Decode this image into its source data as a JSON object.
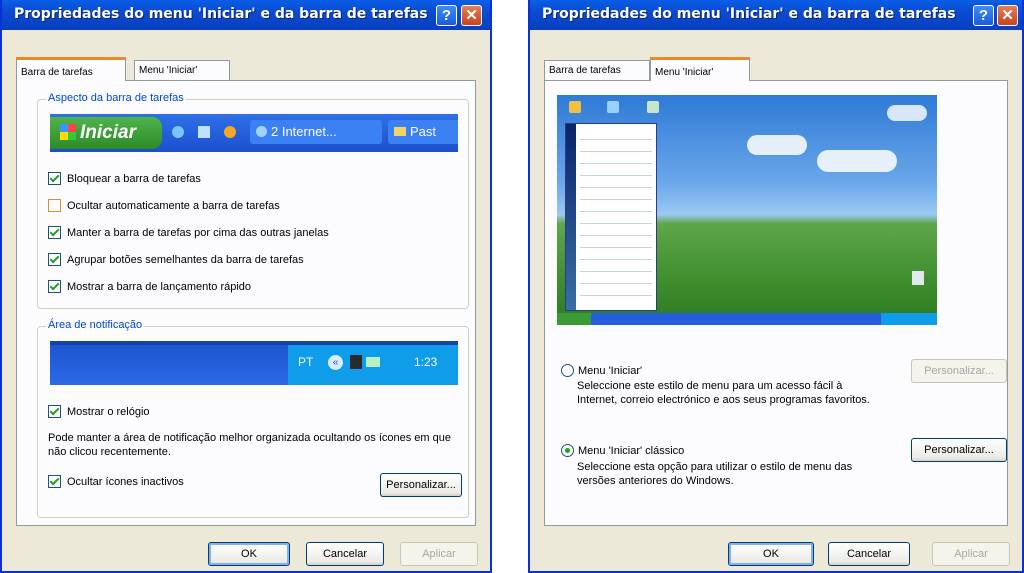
{
  "left": {
    "window_title": "Propriedades do menu 'Iniciar' e da barra de tarefas",
    "help_glyph": "?",
    "close_glyph": "✕",
    "tabs": [
      "Barra de tarefas",
      "Menu 'Iniciar'"
    ],
    "taskbar_group": {
      "title": "Aspecto da barra de tarefas",
      "preview": {
        "start_label": "Iniciar",
        "task_label": "2 Internet...",
        "folder_label": "Past"
      },
      "options": [
        {
          "label": "Bloquear a barra de tarefas",
          "checked": true
        },
        {
          "label": "Ocultar automaticamente a barra de tarefas",
          "checked": false
        },
        {
          "label": "Manter a barra de tarefas por cima das outras janelas",
          "checked": true
        },
        {
          "label": "Agrupar botões semelhantes da barra de tarefas",
          "checked": true
        },
        {
          "label": "Mostrar a barra de lançamento rápido",
          "checked": true
        }
      ]
    },
    "notify_group": {
      "title": "Área de notificação",
      "preview": {
        "lang": "PT",
        "clock": "1:23"
      },
      "show_clock": {
        "label": "Mostrar o relógio",
        "checked": true
      },
      "info": "Pode manter a área de notificação melhor organizada ocultando os ícones em que não clicou recentemente.",
      "hide_inactive": {
        "label": "Ocultar ícones inactivos",
        "checked": true
      },
      "customize": "Personalizar..."
    },
    "buttons": {
      "ok": "OK",
      "cancel": "Cancelar",
      "apply": "Aplicar"
    }
  },
  "right": {
    "window_title": "Propriedades do menu 'Iniciar' e da barra de tarefas",
    "help_glyph": "?",
    "close_glyph": "✕",
    "tabs": [
      "Barra de tarefas",
      "Menu 'Iniciar'"
    ],
    "option1": {
      "label": "Menu 'Iniciar'",
      "selected": false,
      "description": "Seleccione este estilo de menu para um acesso fácil à Internet, correio electrónico e aos seus programas favoritos.",
      "customize": "Personalizar..."
    },
    "option2": {
      "label": "Menu 'Iniciar' clássico",
      "selected": true,
      "description": "Seleccione esta opção para utilizar o estilo de menu das versões anteriores do Windows.",
      "customize": "Personalizar..."
    },
    "buttons": {
      "ok": "OK",
      "cancel": "Cancelar",
      "apply": "Aplicar"
    }
  },
  "colors": {
    "title_blue": "#0a4bd2",
    "group_title": "#0046d5",
    "tab_accent": "#e68b2c",
    "check_green": "#21a121"
  }
}
